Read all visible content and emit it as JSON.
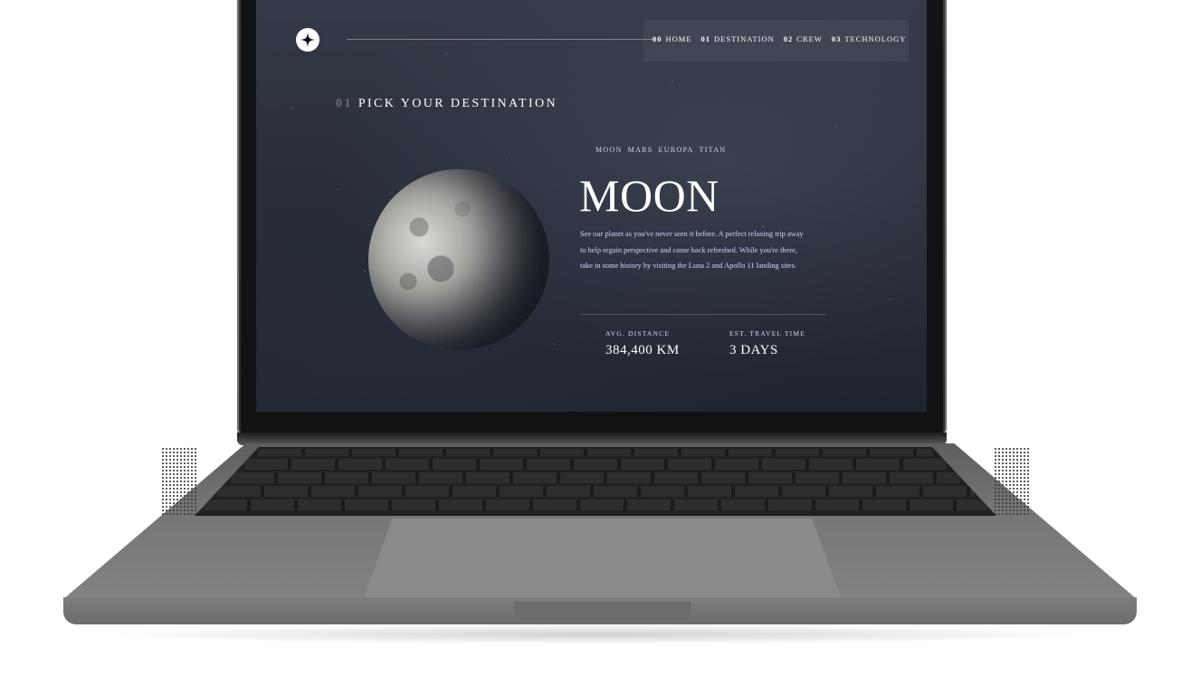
{
  "nav": {
    "items": [
      {
        "num": "00",
        "label": "HOME"
      },
      {
        "num": "01",
        "label": "DESTINATION"
      },
      {
        "num": "02",
        "label": "CREW"
      },
      {
        "num": "03",
        "label": "TECHNOLOGY"
      }
    ]
  },
  "heading": {
    "num": "01",
    "text": "PICK YOUR DESTINATION"
  },
  "tabs": [
    "MOON",
    "MARS",
    "EUROPA",
    "TITAN"
  ],
  "destination": {
    "name": "MOON",
    "description": "See our planet as you've never seen it before. A perfect relaxing trip away to help regain perspective and come back refreshed. While you're there, take in some history by visiting the Luna 2 and Apollo 11 landing sites.",
    "distance_label": "AVG. DISTANCE",
    "distance_value": "384,400 KM",
    "travel_label": "EST. TRAVEL TIME",
    "travel_value": "3 DAYS"
  },
  "colors": {
    "accent": "#d0d6f9",
    "background": "#262b36"
  },
  "icons": {
    "logo": "star-icon"
  }
}
